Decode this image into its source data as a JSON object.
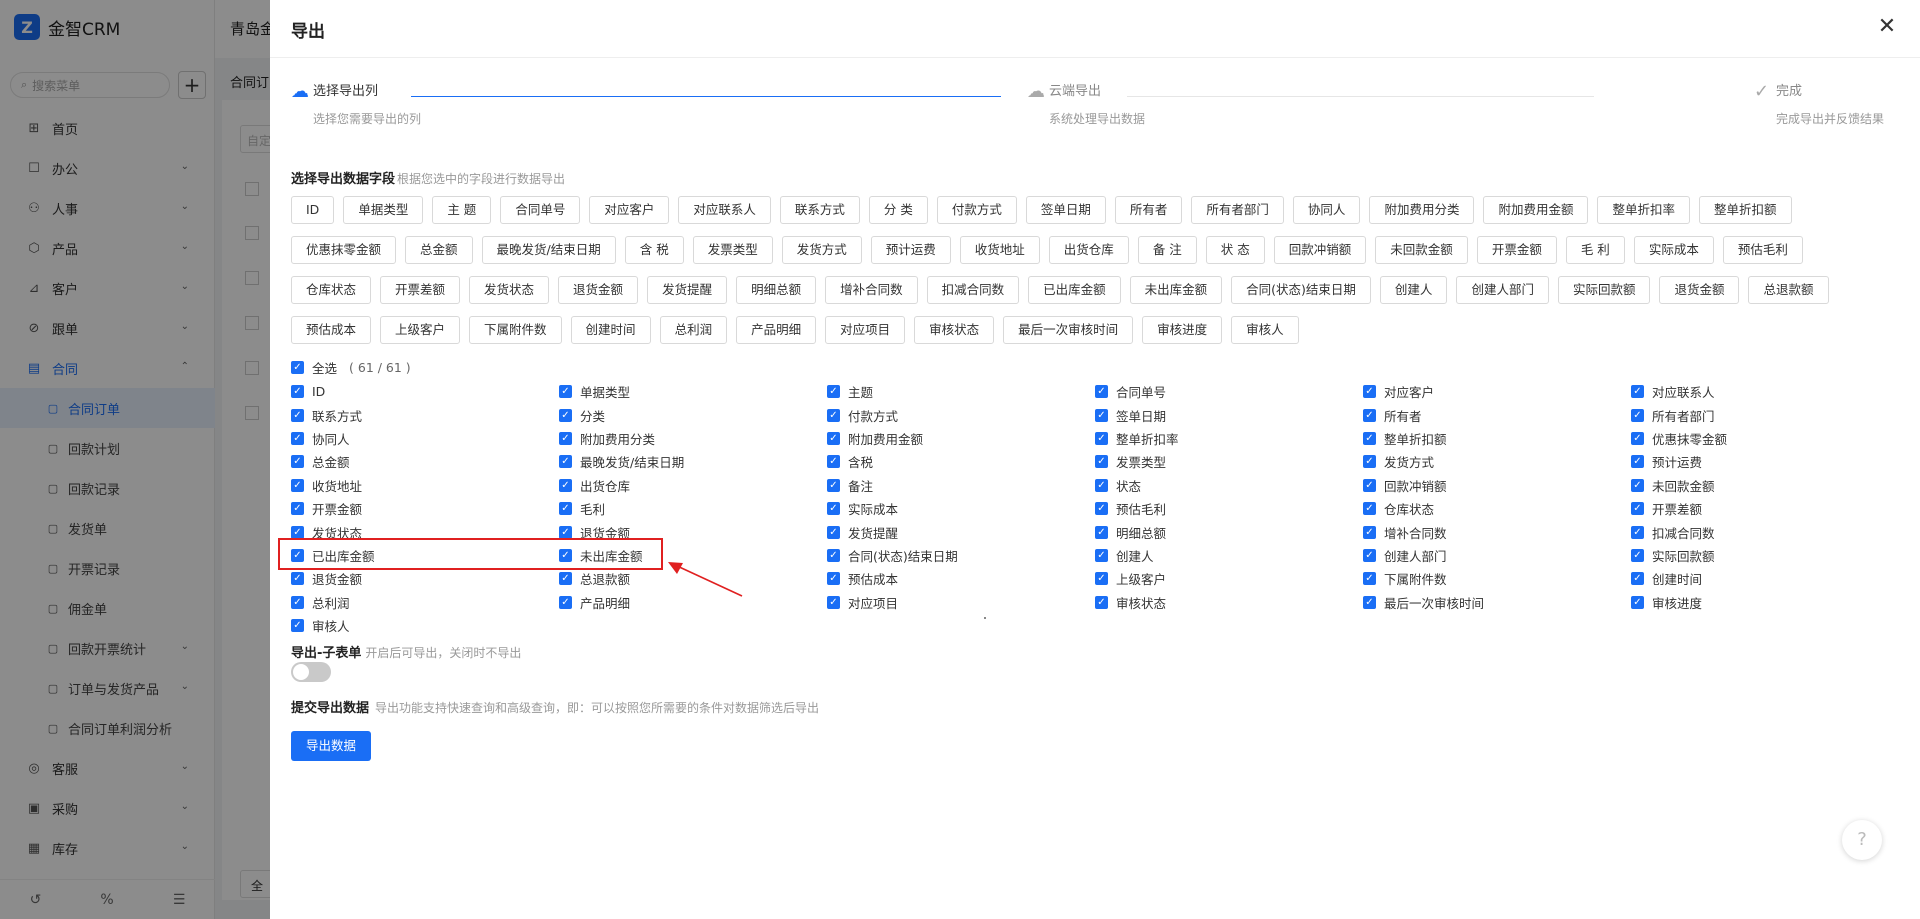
{
  "app": {
    "name": "金智CRM",
    "logo_letter": "Z"
  },
  "sidebar": {
    "search_placeholder": "搜索菜单",
    "add_label": "+",
    "items": [
      {
        "label": "首页",
        "icon": "⊞",
        "chev": ""
      },
      {
        "label": "办公",
        "icon": "☐",
        "chev": "⌄"
      },
      {
        "label": "人事",
        "icon": "⚇",
        "chev": "⌄"
      },
      {
        "label": "产品",
        "icon": "⬡",
        "chev": "⌄"
      },
      {
        "label": "客户",
        "icon": "⊿",
        "chev": "⌄"
      },
      {
        "label": "跟单",
        "icon": "⊘",
        "chev": "⌄"
      },
      {
        "label": "合同",
        "icon": "▤",
        "chev": "⌃"
      }
    ],
    "sub_items": [
      {
        "label": "合同订单",
        "icon": "▢",
        "chev": ""
      },
      {
        "label": "回款计划",
        "icon": "▢",
        "chev": ""
      },
      {
        "label": "回款记录",
        "icon": "▢",
        "chev": ""
      },
      {
        "label": "发货单",
        "icon": "▢",
        "chev": ""
      },
      {
        "label": "开票记录",
        "icon": "▢",
        "chev": ""
      },
      {
        "label": "佣金单",
        "icon": "▢",
        "chev": ""
      },
      {
        "label": "回款开票统计",
        "icon": "▢",
        "chev": "⌄"
      },
      {
        "label": "订单与发货产品",
        "icon": "▢",
        "chev": "⌄"
      },
      {
        "label": "合同订单利润分析",
        "icon": "▢",
        "chev": ""
      }
    ],
    "bottom_items": [
      {
        "label": "客服",
        "icon": "◎",
        "chev": "⌄"
      },
      {
        "label": "采购",
        "icon": "▣",
        "chev": "⌄"
      },
      {
        "label": "库存",
        "icon": "▦",
        "chev": "⌄"
      }
    ],
    "footer": {
      "history_icon": "↺",
      "percent_icon": "%",
      "collapse_icon": "☰"
    }
  },
  "background": {
    "title": "青岛金",
    "tab": "合同订",
    "input_placeholder": "自定",
    "button": "全"
  },
  "drawer": {
    "title": "导出",
    "close_icon": "✕",
    "steps": [
      {
        "title": "选择导出列",
        "desc": "选择您需要导出的列",
        "icon": "☁"
      },
      {
        "title": "云端导出",
        "desc": "系统处理导出数据",
        "icon": "☁"
      },
      {
        "title": "完成",
        "desc": "完成导出并反馈结果",
        "icon": "✓"
      }
    ],
    "field_section": {
      "title": "选择导出数据字段",
      "hint": "根据您选中的字段进行数据导出"
    },
    "tags": [
      "ID",
      "单据类型",
      "主 题",
      "合同单号",
      "对应客户",
      "对应联系人",
      "联系方式",
      "分 类",
      "付款方式",
      "签单日期",
      "所有者",
      "所有者部门",
      "协同人",
      "附加费用分类",
      "附加费用金额",
      "整单折扣率",
      "整单折扣额",
      "优惠抹零金额",
      "总金额",
      "最晚发货/结束日期",
      "含 税",
      "发票类型",
      "发货方式",
      "预计运费",
      "收货地址",
      "出货仓库",
      "备 注",
      "状 态",
      "回款冲销额",
      "未回款金额",
      "开票金额",
      "毛 利",
      "实际成本",
      "预估毛利",
      "仓库状态",
      "开票差额",
      "发货状态",
      "退货金额",
      "发货提醒",
      "明细总额",
      "增补合同数",
      "扣减合同数",
      "已出库金额",
      "未出库金额",
      "合同(状态)结束日期",
      "创建人",
      "创建人部门",
      "实际回款额",
      "退货金额",
      "总退款额",
      "预估成本",
      "上级客户",
      "下属附件数",
      "创建时间",
      "总利润",
      "产品明细",
      "对应项目",
      "审核状态",
      "最后一次审核时间",
      "审核进度",
      "审核人"
    ],
    "select_all": {
      "label": "全选",
      "count": "( 61 / 61 )"
    },
    "checkboxes": [
      "ID",
      "单据类型",
      "主题",
      "合同单号",
      "对应客户",
      "对应联系人",
      "联系方式",
      "分类",
      "付款方式",
      "签单日期",
      "所有者",
      "所有者部门",
      "协同人",
      "附加费用分类",
      "附加费用金额",
      "整单折扣率",
      "整单折扣额",
      "优惠抹零金额",
      "总金额",
      "最晚发货/结束日期",
      "含税",
      "发票类型",
      "发货方式",
      "预计运费",
      "收货地址",
      "出货仓库",
      "备注",
      "状态",
      "回款冲销额",
      "未回款金额",
      "开票金额",
      "毛利",
      "实际成本",
      "预估毛利",
      "仓库状态",
      "开票差额",
      "发货状态",
      "退货金额",
      "发货提醒",
      "明细总额",
      "增补合同数",
      "扣减合同数",
      "已出库金额",
      "未出库金额",
      "合同(状态)结束日期",
      "创建人",
      "创建人部门",
      "实际回款额",
      "退货金额",
      "总退款额",
      "预估成本",
      "上级客户",
      "下属附件数",
      "创建时间",
      "总利润",
      "产品明细",
      "对应项目",
      "审核状态",
      "最后一次审核时间",
      "审核进度",
      "审核人"
    ],
    "check_glyph": "✓",
    "sub_table": {
      "title": "导出-子表单",
      "hint": "开启后可导出，关闭时不导出",
      "enabled": false
    },
    "submit": {
      "title": "提交导出数据",
      "hint": "导出功能支持快速查询和高级查询，即：可以按照您所需要的条件对数据筛选后导出",
      "button": "导出数据"
    },
    "help_icon": "?",
    "colors": {
      "accent": "#1a6ef5",
      "annotation": "#e02020"
    }
  }
}
